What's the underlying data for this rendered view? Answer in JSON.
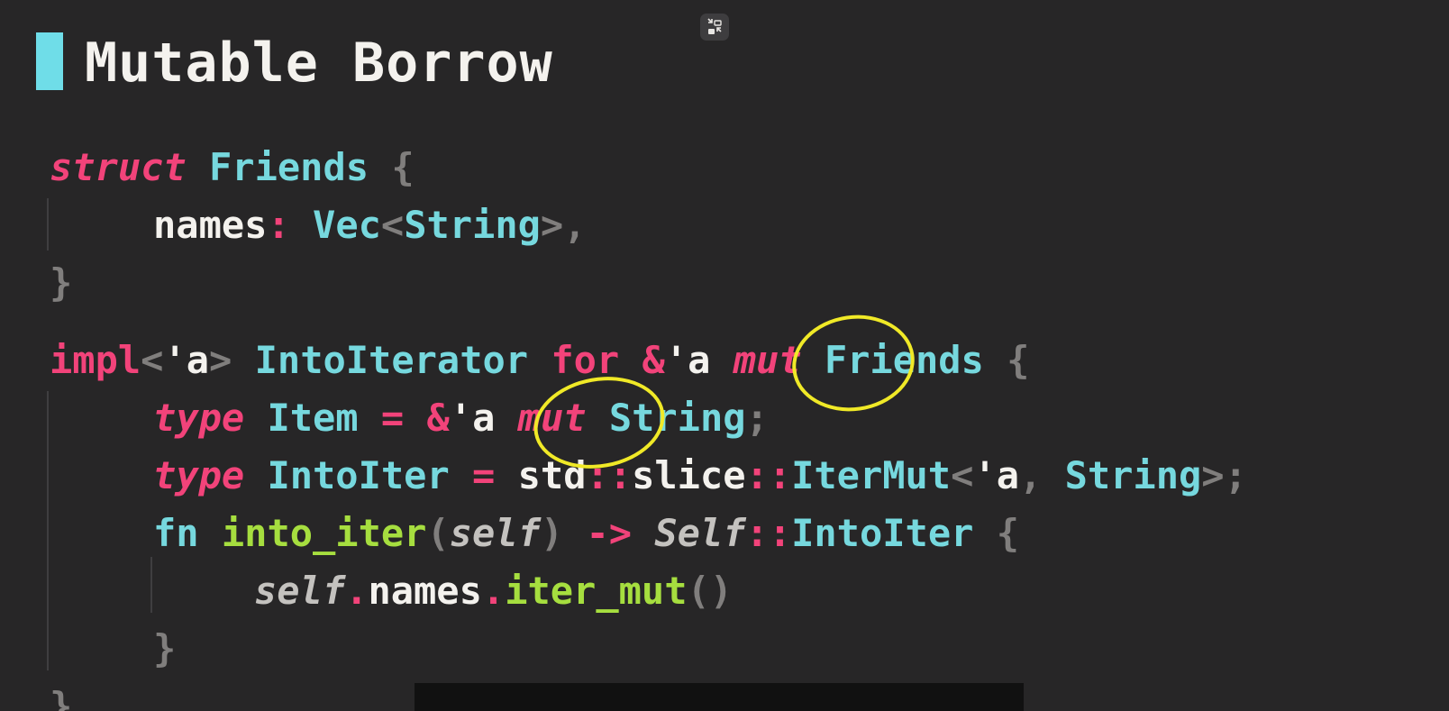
{
  "slide": {
    "title": "Mutable Borrow",
    "accent_color": "#6fdde8",
    "exit_fullscreen_icon": "exit-fullscreen-icon",
    "annotation_color": "#f0e927"
  },
  "code": {
    "language": "rust",
    "l1": {
      "kw": "struct",
      "name": "Friends",
      "brace": "{"
    },
    "l2": {
      "field": "names",
      "colon": ":",
      "type": "Vec",
      "lt": "<",
      "inner": "String",
      "gt": ">",
      "comma": ","
    },
    "l3": {
      "close": "}"
    },
    "l4": {
      "impl": "impl",
      "lt": "<",
      "lifetime": "'a",
      "gt": ">",
      "trait": "IntoIterator",
      "for": "for",
      "amp": "&",
      "lifetime2": "'a",
      "mut": "mut",
      "name": "Friends",
      "brace": "{"
    },
    "l5": {
      "type_kw": "type",
      "name": "Item",
      "eq": "=",
      "amp": "&",
      "lifetime": "'a",
      "mut": "mut",
      "target": "String",
      "semi": ";"
    },
    "l6": {
      "type_kw": "type",
      "name": "IntoIter",
      "eq": "=",
      "std": "std",
      "sep1": "::",
      "slice": "slice",
      "sep2": "::",
      "itermut": "IterMut",
      "lt": "<",
      "lifetime": "'a",
      "comma": ",",
      "target": "String",
      "gt": ">",
      "semi": ";"
    },
    "l7": {
      "fn_kw": "fn",
      "name": "into_iter",
      "open": "(",
      "self": "self",
      "close": ")",
      "arrow": "->",
      "Self": "Self",
      "sep": "::",
      "assoc": "IntoIter",
      "brace": "{"
    },
    "l8": {
      "self": "self",
      "dot1": ".",
      "field": "names",
      "dot2": ".",
      "method": "iter_mut",
      "parens": "()"
    },
    "l9": {
      "close": "}"
    },
    "l10": {
      "close": "}"
    }
  }
}
